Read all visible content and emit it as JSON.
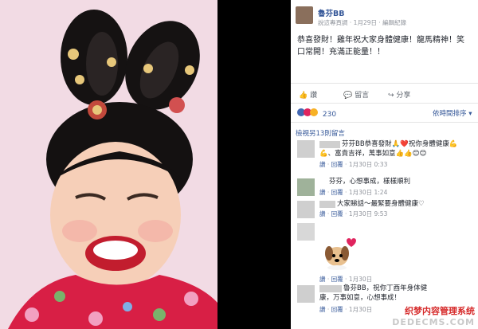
{
  "post": {
    "author": "魯芬BB",
    "date": "1月29日",
    "menu_label": "說這專頁調",
    "edit_history": "編輯紀錄",
    "text_line1": "恭喜發財！雞年祝大家身體健康！龍馬精神！笑",
    "text_line2": "口常開！充滿正能量！！",
    "actions": {
      "like": "讚",
      "comment": "留言",
      "share": "分享"
    },
    "reaction_count": "230",
    "sort_label": "依時間排序"
  },
  "comments_header": "檢視另13則留言",
  "comments": [
    {
      "line1": "芬芬BB恭喜發財🙏❤️祝你身體健康💪",
      "line2": "💪、富貴吉祥，萬事如意👍👍😊😊",
      "meta_like": "讚",
      "meta_reply": "回覆",
      "meta_time": "1月30日 0:33"
    },
    {
      "line1": "芬芬，心想事成，樣樣順利",
      "meta_like": "讚",
      "meta_reply": "回覆",
      "meta_time": "1月30日 1:24"
    },
    {
      "line1": "大家睇話～最緊要身體健康♡",
      "meta_like": "讚",
      "meta_reply": "回覆",
      "meta_time": "1月30日 9:53"
    },
    {
      "meta_like": "讚",
      "meta_reply": "回覆",
      "meta_time": "1月30日"
    },
    {
      "line1": "魯芬BB，祝你丁酉年身体健",
      "line2": "康，万事如意，心想事成！",
      "meta_like": "讚",
      "meta_reply": "回覆",
      "meta_time": "1月30日"
    }
  ],
  "watermark": {
    "cn": "织梦内容管理系统",
    "url": "DEDECMS.COM"
  },
  "colors": {
    "fb_blue": "#365899",
    "black": "#000000",
    "love_red": "#e0245e"
  }
}
